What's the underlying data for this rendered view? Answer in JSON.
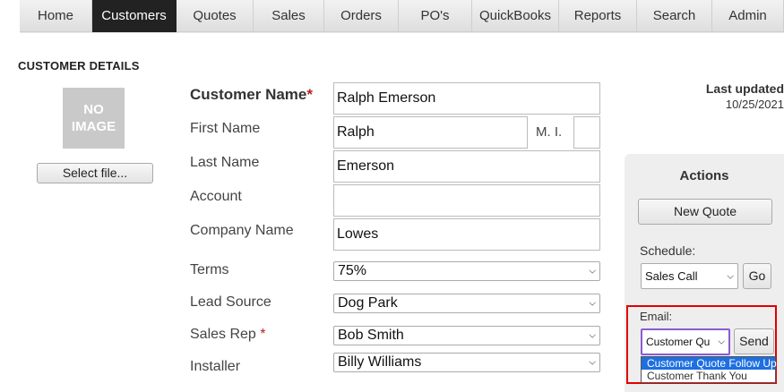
{
  "nav": {
    "tabs": [
      "Home",
      "Customers",
      "Quotes",
      "Sales",
      "Orders",
      "PO's",
      "QuickBooks",
      "Reports",
      "Search",
      "Admin"
    ],
    "active": "Customers"
  },
  "section_title": "CUSTOMER DETAILS",
  "photo": {
    "placeholder": "NO IMAGE",
    "select_file_label": "Select file..."
  },
  "form": {
    "customer_name": {
      "label": "Customer Name",
      "required_mark": "*",
      "value": "Ralph Emerson"
    },
    "first_name": {
      "label": "First Name",
      "value": "Ralph"
    },
    "mi": {
      "label": "M. I.",
      "value": ""
    },
    "last_name": {
      "label": "Last Name",
      "value": "Emerson"
    },
    "account": {
      "label": "Account",
      "value": ""
    },
    "company_name": {
      "label": "Company Name",
      "value": "Lowes"
    },
    "terms": {
      "label": "Terms",
      "value": "75%"
    },
    "lead_source": {
      "label": "Lead Source",
      "value": "Dog Park"
    },
    "sales_rep": {
      "label": "Sales Rep",
      "required_mark": "*",
      "value": "Bob Smith"
    },
    "installer": {
      "label": "Installer",
      "value": "Billy Williams"
    }
  },
  "last_updated": {
    "label": "Last updated",
    "value": "10/25/2021"
  },
  "actions": {
    "title": "Actions",
    "new_quote_label": "New Quote",
    "schedule_label": "Schedule:",
    "schedule_value": "Sales Call",
    "go_label": "Go",
    "email_label": "Email:",
    "email_value": "Customer Qu",
    "send_label": "Send",
    "email_options": [
      "Customer Quote Follow Up",
      "Customer Thank You"
    ]
  },
  "colors": {
    "nav_active_bg": "#222222",
    "highlight_border": "#e00000",
    "dropdown_selected": "#1e6fe0",
    "required": "#b22222"
  }
}
